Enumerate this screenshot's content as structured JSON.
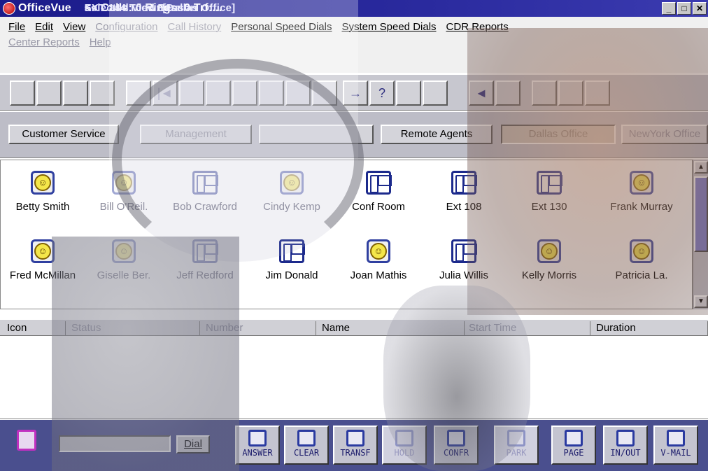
{
  "window": {
    "app_name": "OfficeVue",
    "ext_user": "EXT 144 Todd Benson",
    "selected_view": "Selected View: [Dallas Office]",
    "call_status": "<< Calls: 0  Rings: 0  Trf:...",
    "buttons": {
      "minimize": "_",
      "maximize": "□",
      "close": "✕"
    }
  },
  "menu": {
    "row1": [
      {
        "label": "File",
        "dim": false
      },
      {
        "label": "Edit",
        "dim": false
      },
      {
        "label": "View",
        "dim": false
      },
      {
        "label": "Configuration",
        "dim": true
      },
      {
        "label": "Call History",
        "dim": true
      },
      {
        "label": "Personal Speed Dials",
        "dim": false
      },
      {
        "label": "System Speed Dials",
        "dim": false
      },
      {
        "label": "CDR Reports",
        "dim": false
      }
    ],
    "row2": [
      {
        "label": "Center Reports",
        "dim": true
      },
      {
        "label": "Help",
        "dim": true
      }
    ]
  },
  "toolbar": {
    "help_glyph": "?",
    "arrow_glyph": "→",
    "back_glyph": "◄",
    "skip_glyph": "|◄"
  },
  "view_tabs": [
    {
      "label": "Customer Service",
      "dim": false,
      "active": false
    },
    {
      "label": "Management",
      "dim": true,
      "active": false
    },
    {
      "label": "",
      "dim": false,
      "active": false
    },
    {
      "label": "Remote Agents",
      "dim": false,
      "active": false
    },
    {
      "label": "Dallas Office",
      "dim": true,
      "active": true
    },
    {
      "label": "NewYork Office",
      "dim": true,
      "active": false
    }
  ],
  "extensions": [
    {
      "name": "Betty Smith",
      "type": "smiley",
      "dim": false
    },
    {
      "name": "Bill O'Reil.",
      "type": "smiley",
      "dim": true
    },
    {
      "name": "Bob Crawford",
      "type": "phone",
      "dim": true
    },
    {
      "name": "Cindy Kemp",
      "type": "smiley",
      "dim": true
    },
    {
      "name": "Conf Room",
      "type": "phone",
      "dim": false
    },
    {
      "name": "Ext 108",
      "type": "phone",
      "dim": false
    },
    {
      "name": "Ext 130",
      "type": "phone",
      "dim": false
    },
    {
      "name": "Frank Murray",
      "type": "smiley",
      "dim": false
    },
    {
      "name": "Fred McMillan",
      "type": "smiley",
      "dim": false
    },
    {
      "name": "Giselle Ber.",
      "type": "smiley",
      "dim": true
    },
    {
      "name": "Jeff Redford",
      "type": "phone",
      "dim": true
    },
    {
      "name": "Jim Donald",
      "type": "phone",
      "dim": false
    },
    {
      "name": "Joan Mathis",
      "type": "smiley",
      "dim": false
    },
    {
      "name": "Julia Willis",
      "type": "phone",
      "dim": false
    },
    {
      "name": "Kelly Morris",
      "type": "smiley",
      "dim": false
    },
    {
      "name": "Patricia La.",
      "type": "smiley",
      "dim": false
    }
  ],
  "call_list": {
    "columns": [
      {
        "label": "Icon",
        "dim": false
      },
      {
        "label": "Status",
        "dim": true
      },
      {
        "label": "Number",
        "dim": true
      },
      {
        "label": "Name",
        "dim": false
      },
      {
        "label": "Start Time",
        "dim": true
      },
      {
        "label": "Duration",
        "dim": false
      }
    ]
  },
  "dial": {
    "input_value": "",
    "button": "Dial"
  },
  "actions": [
    {
      "label": "ANSWER",
      "dim": false
    },
    {
      "label": "CLEAR",
      "dim": false
    },
    {
      "label": "TRANSF",
      "dim": false
    },
    {
      "label": "HOLD",
      "dim": true
    },
    {
      "label": "CONFR",
      "dim": false
    },
    {
      "label": "PARK",
      "dim": true
    },
    {
      "label": "PAGE",
      "dim": false
    },
    {
      "label": "IN/OUT",
      "dim": false
    },
    {
      "label": "V-MAIL",
      "dim": false
    }
  ],
  "colors": {
    "titlebar": "#1b1b8a",
    "accent": "#2a3aa0",
    "bottombar": "#4a4f8e"
  }
}
